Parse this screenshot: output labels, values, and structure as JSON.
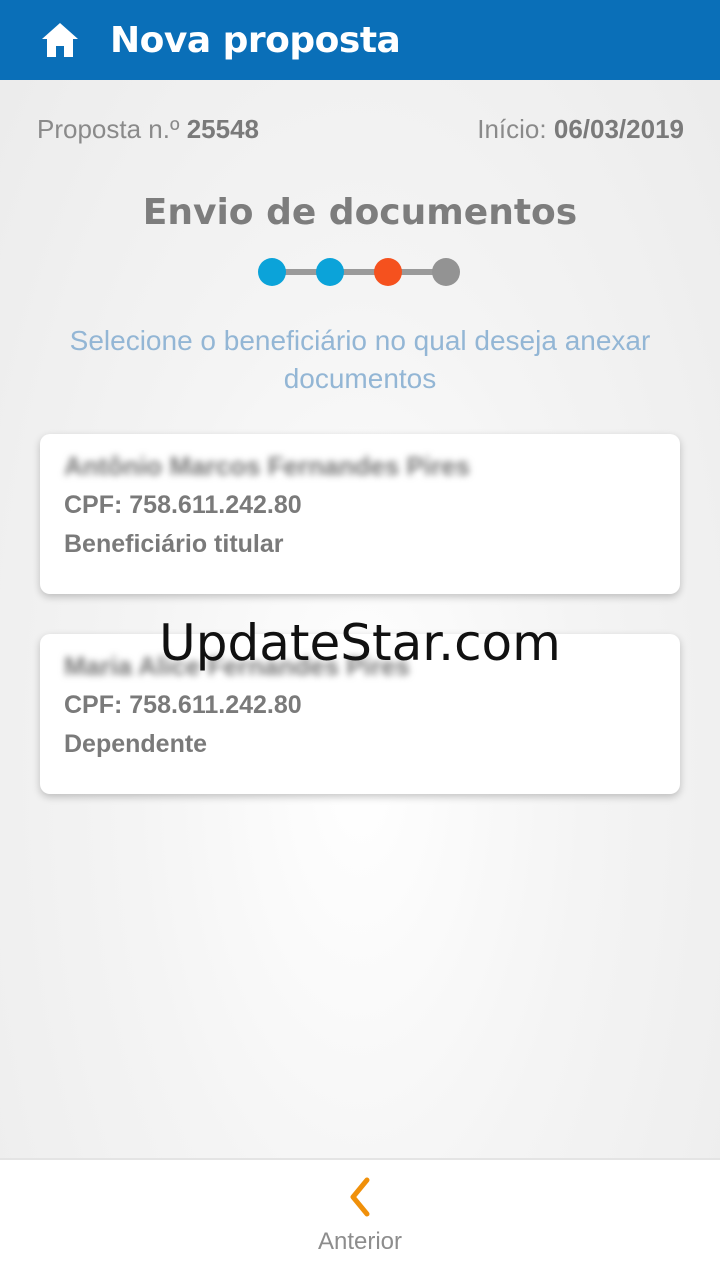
{
  "header": {
    "title": "Nova proposta",
    "home_icon": "home-icon",
    "background": "#0a6fb8"
  },
  "meta": {
    "proposal_label": "Proposta n.º",
    "proposal_number": "25548",
    "start_label": "Início:",
    "start_date": "06/03/2019"
  },
  "step": {
    "title": "Envio de documentos",
    "total": 4,
    "current": 3,
    "colors": {
      "done": "#0ba3d9",
      "active": "#f5511e",
      "pending": "#939393"
    }
  },
  "instruction": "Selecione o beneficiário no qual deseja anexar documentos",
  "beneficiaries": [
    {
      "name": "Antônio Marcos Fernandes Pires",
      "cpf": "CPF: 758.611.242.80",
      "role": "Beneficiário titular"
    },
    {
      "name": "Maria Alice Fernandes Pires",
      "cpf": "CPF: 758.611.242.80",
      "role": "Dependente"
    }
  ],
  "watermark": "UpdateStar.com",
  "footer": {
    "prev_label": "Anterior",
    "prev_icon": "chevron-left-icon",
    "accent": "#f0900a"
  }
}
